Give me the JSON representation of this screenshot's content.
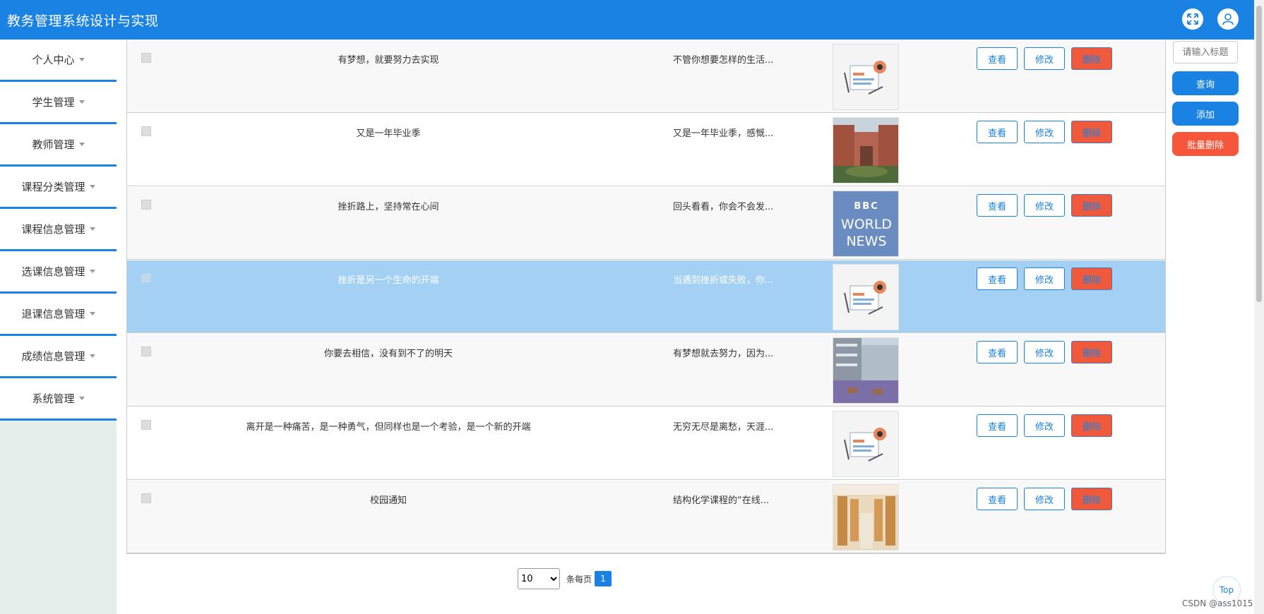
{
  "header": {
    "title": "教务管理系统设计与实现",
    "expand_icon": "expand-icon",
    "user_icon": "user-icon"
  },
  "sidebar": {
    "items": [
      {
        "label": "个人中心"
      },
      {
        "label": "学生管理"
      },
      {
        "label": "教师管理"
      },
      {
        "label": "课程分类管理"
      },
      {
        "label": "课程信息管理"
      },
      {
        "label": "选课信息管理"
      },
      {
        "label": "退课信息管理"
      },
      {
        "label": "成绩信息管理"
      },
      {
        "label": "系统管理"
      }
    ]
  },
  "table": {
    "rows": [
      {
        "title": "有梦想，就要努力去实现",
        "summary": "不管你想要怎样的生活...",
        "image": "news-icon-thumb",
        "selected": false
      },
      {
        "title": "又是一年毕业季",
        "summary": "又是一年毕业季，感慨...",
        "image": "campus-building-photo",
        "selected": false
      },
      {
        "title": "挫折路上，坚持常在心间",
        "summary": "回头看看，你会不会发...",
        "image": "bbc-world-news-logo",
        "selected": false
      },
      {
        "title": "挫折是另一个生命的开端",
        "summary": "当遇到挫折或失败，你...",
        "image": "news-icon-thumb",
        "selected": true
      },
      {
        "title": "你要去相信，没有到不了的明天",
        "summary": "有梦想就去努力，因为...",
        "image": "modern-campus-photo",
        "selected": false
      },
      {
        "title": "离开是一种痛苦，是一种勇气，但同样也是一个考验，是一个新的开端",
        "summary": "无穷无尽是离愁，天涯...",
        "image": "news-icon-thumb",
        "selected": false
      },
      {
        "title": "校园通知",
        "summary": "结构化学课程的“在线...",
        "image": "library-study-photo",
        "selected": false
      }
    ],
    "buttons": {
      "view": "查看",
      "edit": "修改",
      "delete": "删除"
    }
  },
  "side_panel": {
    "search_placeholder": "请输入标题",
    "search_button": "查询",
    "add_button": "添加",
    "batch_delete_button": "批量删除"
  },
  "pagination": {
    "page_size": "10",
    "page_size_options": [
      "10"
    ],
    "per_page_label": "条每页",
    "current_page": "1"
  },
  "bbc_logo": {
    "line1": "BBC",
    "line2": "WORLD",
    "line3": "NEWS"
  },
  "top_button": "Top",
  "watermark": "CSDN @ass1015",
  "colors": {
    "primary": "#1a82e2",
    "danger": "#f05a3c",
    "selected_row": "#a3d0f3",
    "sidebar_bg": "#e4efec"
  }
}
